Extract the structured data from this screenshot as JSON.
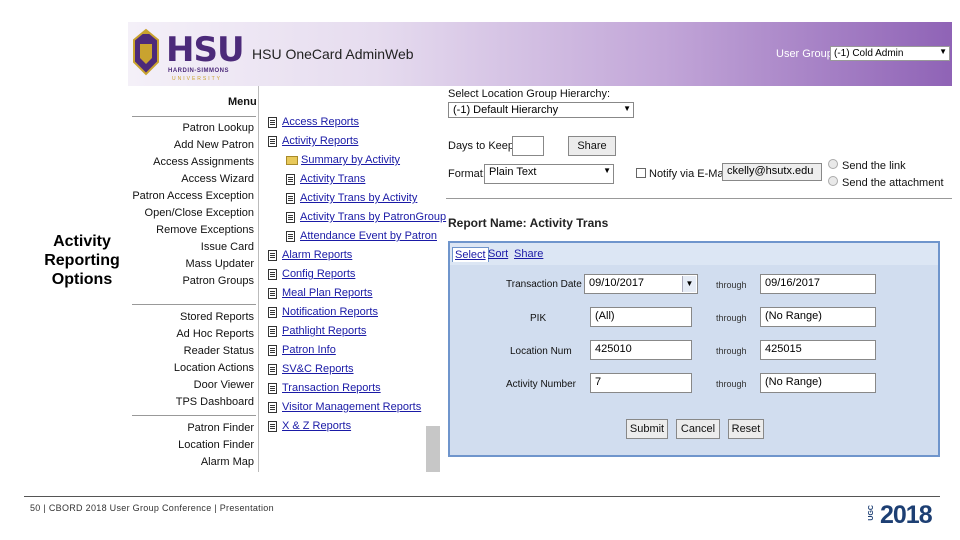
{
  "slide": {
    "caption_lines": [
      "Activity",
      "Reporting",
      "Options"
    ],
    "footer": "50 | CBORD 2018 User Group Conference | Presentation",
    "mark_prefix": "UGC",
    "mark_year": "2018"
  },
  "app": {
    "logo": "HSU",
    "logo_sub": "HARDIN-SIMMONS",
    "logo_sub2": "UNIVERSITY",
    "title": "HSU OneCard AdminWeb",
    "user_group_label": "User Group:",
    "user_group_value": "(-1) Cold Admin",
    "colors": {
      "banner_start": "#f4f0f8",
      "banner_end": "#8f63b6",
      "tab_border": "#6f95cc",
      "link": "#1a1aa6"
    }
  },
  "menu": {
    "title": "Menu",
    "group1": [
      "Patron Lookup",
      "Add New Patron",
      "Access Assignments",
      "Access Wizard",
      "Patron Access Exception",
      "Open/Close Exception",
      "Remove Exceptions",
      "Issue Card",
      "Mass Updater",
      "Patron Groups"
    ],
    "group2": [
      "Stored Reports",
      "Ad Hoc Reports",
      "Reader Status",
      "Location Actions",
      "Door Viewer",
      "TPS Dashboard"
    ],
    "group3": [
      "Patron Finder",
      "Location Finder",
      "Alarm Map"
    ]
  },
  "tree": {
    "items": [
      {
        "label": "Access Reports",
        "icon": "doc-icon",
        "level": 0
      },
      {
        "label": "Activity Reports",
        "icon": "doc-icon",
        "level": 0
      },
      {
        "label": "Summary by Activity",
        "icon": "folder-icon",
        "level": 1
      },
      {
        "label": "Activity Trans",
        "icon": "doc-icon",
        "level": 1
      },
      {
        "label": "Activity Trans by Activity",
        "icon": "doc-icon",
        "level": 1
      },
      {
        "label": "Activity Trans by PatronGroup",
        "icon": "doc-icon",
        "level": 1
      },
      {
        "label": "Attendance Event by Patron",
        "icon": "doc-icon",
        "level": 1
      },
      {
        "label": "Alarm Reports",
        "icon": "doc-icon",
        "level": 0
      },
      {
        "label": "Config Reports",
        "icon": "doc-icon",
        "level": 0
      },
      {
        "label": "Meal Plan Reports",
        "icon": "doc-icon",
        "level": 0
      },
      {
        "label": "Notification Reports",
        "icon": "doc-icon",
        "level": 0
      },
      {
        "label": "Pathlight Reports",
        "icon": "doc-icon",
        "level": 0
      },
      {
        "label": "Patron Info",
        "icon": "doc-icon",
        "level": 0
      },
      {
        "label": "SV&C Reports",
        "icon": "doc-icon",
        "level": 0
      },
      {
        "label": "Transaction Reports",
        "icon": "doc-icon",
        "level": 0
      },
      {
        "label": "Visitor Management Reports",
        "icon": "doc-icon",
        "level": 0
      },
      {
        "label": "X & Z Reports",
        "icon": "doc-icon",
        "level": 0
      }
    ]
  },
  "options": {
    "hierarchy_label": "Select Location Group Hierarchy:",
    "hierarchy_value": "(-1) Default Hierarchy",
    "days_label": "Days to Keep:",
    "days_value": "",
    "share_button": "Share",
    "format_label": "Format:",
    "format_value": "Plain Text",
    "notify_label": "Notify via E-Mail:",
    "email_value": "ckelly@hsutx.edu",
    "send_link": "Send the link",
    "send_attachment": "Send the attachment"
  },
  "report": {
    "name_label": "Report Name: Activity Trans",
    "tabs": [
      "Select",
      "Sort",
      "Share"
    ],
    "through_label": "through",
    "params": [
      {
        "label": "Transaction Date",
        "from": "09/10/2017",
        "to": "09/16/2017",
        "from_dropdown": true
      },
      {
        "label": "PIK",
        "from": "(All)",
        "to": "(No Range)",
        "from_dropdown": false
      },
      {
        "label": "Location Num",
        "from": "425010",
        "to": "425015",
        "from_dropdown": false
      },
      {
        "label": "Activity Number",
        "from": "7",
        "to": "(No Range)",
        "from_dropdown": false
      }
    ],
    "submit": "Submit",
    "cancel": "Cancel",
    "reset": "Reset"
  }
}
